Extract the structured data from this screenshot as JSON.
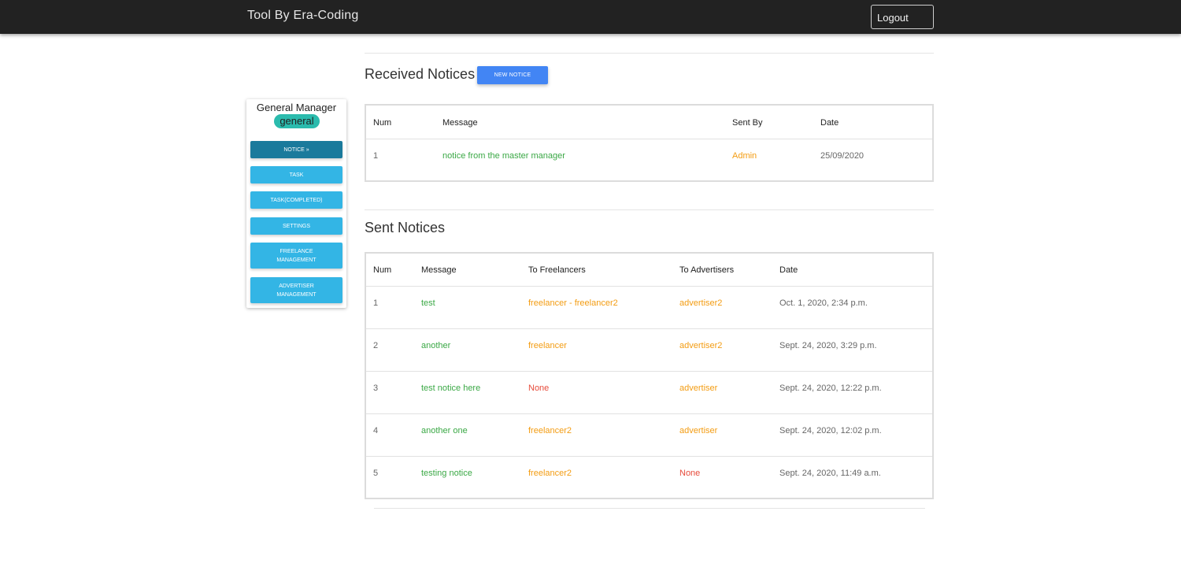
{
  "header": {
    "brand": "Tool By Era-Coding",
    "logout_label": "Logout"
  },
  "sidebar": {
    "name": "General Manager",
    "role_badge": "general",
    "items": [
      {
        "label": "NOTICE »",
        "active": true
      },
      {
        "label": "TASK",
        "active": false
      },
      {
        "label": "TASK(COMPLETED)",
        "active": false
      },
      {
        "label": "SETTINGS",
        "active": false
      },
      {
        "label": "FREELANCE MANAGEMENT",
        "active": false
      },
      {
        "label": "ADVERTISER MANAGEMENT",
        "active": false
      }
    ]
  },
  "received": {
    "title": "Received Notices",
    "new_button": "NEW NOTICE",
    "columns": [
      "Num",
      "Message",
      "Sent By",
      "Date"
    ],
    "rows": [
      {
        "num": "1",
        "message": "notice from the master manager",
        "sent_by": "Admin",
        "date": "25/09/2020"
      }
    ]
  },
  "sent": {
    "title": "Sent Notices",
    "columns": [
      "Num",
      "Message",
      "To Freelancers",
      "To Advertisers",
      "Date"
    ],
    "rows": [
      {
        "num": "1",
        "message": "test",
        "freelancers": "freelancer - freelancer2",
        "advertisers": "advertiser2",
        "date": "Oct. 1, 2020, 2:34 p.m."
      },
      {
        "num": "2",
        "message": "another",
        "freelancers": "freelancer",
        "advertisers": "advertiser2",
        "date": "Sept. 24, 2020, 3:29 p.m."
      },
      {
        "num": "3",
        "message": "test notice here",
        "freelancers": "None",
        "advertisers": "advertiser",
        "date": "Sept. 24, 2020, 12:22 p.m."
      },
      {
        "num": "4",
        "message": "another one",
        "freelancers": "freelancer2",
        "advertisers": "advertiser",
        "date": "Sept. 24, 2020, 12:02 p.m."
      },
      {
        "num": "5",
        "message": "testing notice",
        "freelancers": "freelancer2",
        "advertisers": "None",
        "date": "Sept. 24, 2020, 11:49 a.m."
      }
    ]
  },
  "colors": {
    "topbar": "#222222",
    "message_text": "#3aa845",
    "recipient_text": "#f39c12",
    "none_text": "#e74c3c",
    "sidebar_button": "#33b5e5",
    "sidebar_button_active": "#1a7a9c",
    "new_notice_button": "#4285f4",
    "role_badge": "#2bbbad"
  }
}
